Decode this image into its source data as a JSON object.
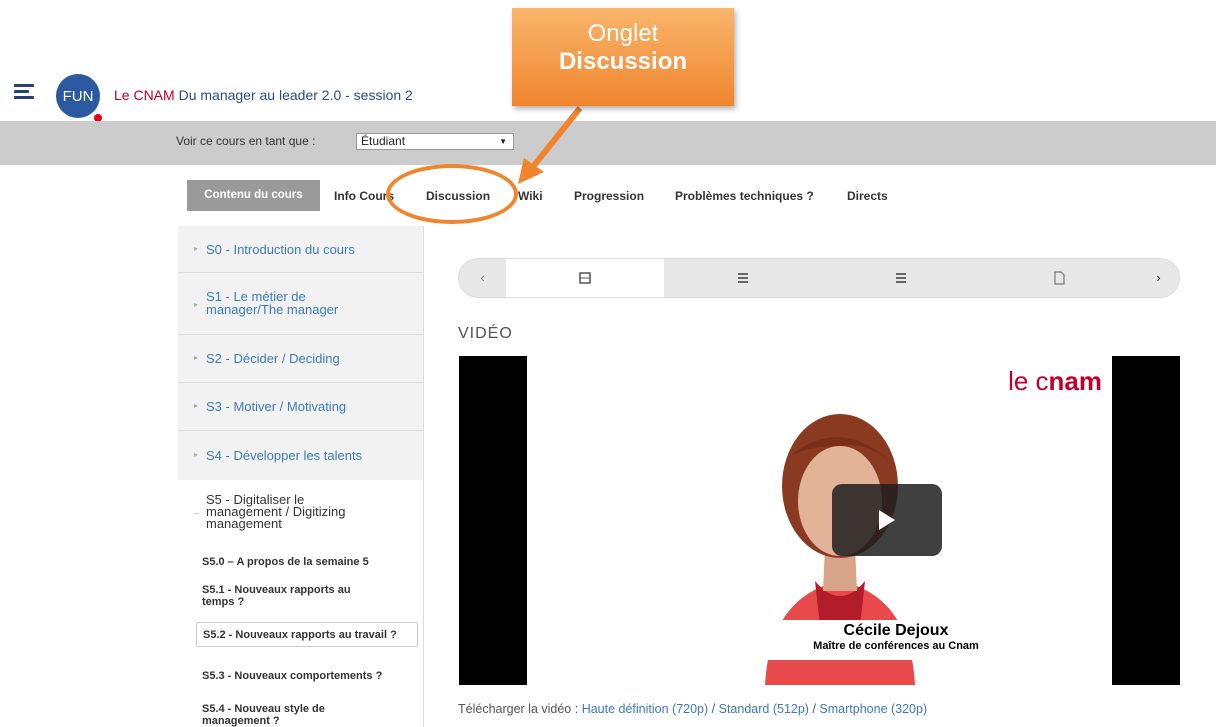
{
  "header": {
    "org": "Le CNAM",
    "course_title": "Du manager au leader 2.0 - session 2",
    "logo_text": "FUN"
  },
  "role_bar": {
    "label": "Voir ce cours en tant que :",
    "selected": "Étudiant"
  },
  "tabs": [
    {
      "label": "Contenu du cours"
    },
    {
      "label": "Info Cours"
    },
    {
      "label": "Discussion"
    },
    {
      "label": "Wiki"
    },
    {
      "label": "Progression"
    },
    {
      "label": "Problèmes techniques ?"
    },
    {
      "label": "Directs"
    }
  ],
  "sidebar": {
    "sections": [
      {
        "label": "S0 - Introduction du cours"
      },
      {
        "label": "S1 - Le métier de manager/The manager"
      },
      {
        "label": "S2 - Décider / Deciding"
      },
      {
        "label": "S3 - Motiver / Motivating"
      },
      {
        "label": "S4 - Développer les talents"
      }
    ],
    "open_section": {
      "label": "S5 - Digitaliser le management / Digitizing management",
      "items": [
        {
          "label": "S5.0 – A propos de la semaine 5"
        },
        {
          "label": "S5.1 - Nouveaux rapports au temps ?"
        },
        {
          "label": "S5.2 - Nouveaux rapports au travail ?"
        },
        {
          "label": "S5.3 - Nouveaux comportements ?"
        },
        {
          "label": "S5.4 - Nouveau style de management ?"
        }
      ]
    }
  },
  "content": {
    "video_heading": "VIDÉO",
    "video_logo_light": "le c",
    "video_logo_bold": "nam",
    "caption_name": "Cécile Dejoux",
    "caption_role": "Maître de conférences au Cnam",
    "download_label": "Télécharger la vidéo :",
    "download_links": [
      "Haute définition (720p)",
      "Standard (512p)",
      "Smartphone (320p)"
    ],
    "download_sep": "/"
  },
  "annotation": {
    "line1": "Onglet",
    "line2": "Discussion",
    "color": "#f0852d"
  },
  "icons": {
    "prev": "‹",
    "next": "›"
  }
}
